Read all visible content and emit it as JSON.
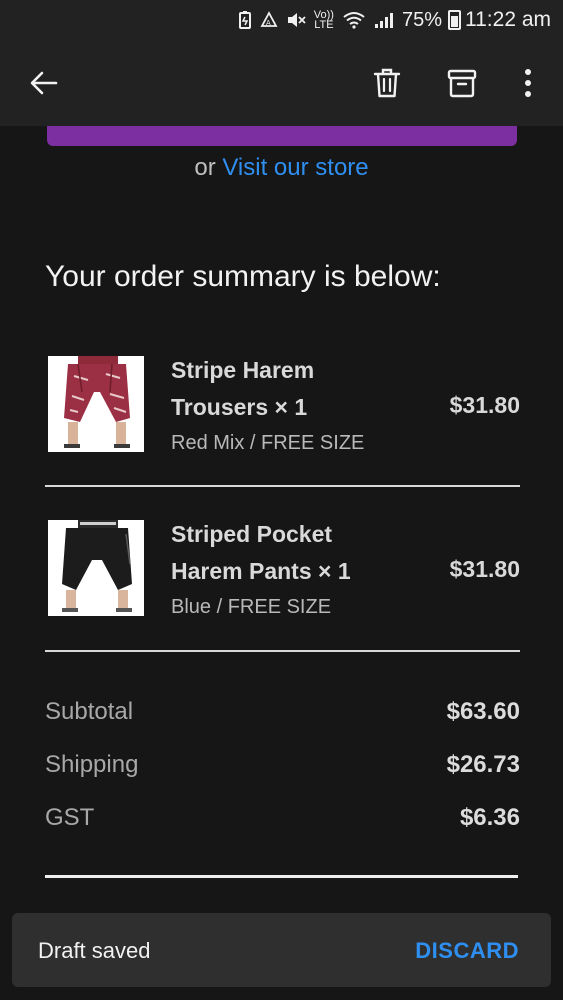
{
  "status_bar": {
    "volte": "Vo))",
    "lte": "LTE",
    "battery_percent": "75%",
    "time": "11:22 am"
  },
  "toolbar": {
    "back_icon": "arrow-left-icon",
    "delete_icon": "trash-icon",
    "archive_icon": "archive-icon",
    "more_icon": "more-vert-icon"
  },
  "email": {
    "visit_prefix": "or",
    "visit_link": "Visit our store",
    "summary_title": "Your order summary is below:",
    "items": [
      {
        "name_line1": "Stripe Harem",
        "name_line2": "Trousers × 1",
        "variant": "Red Mix / FREE SIZE",
        "price": "$31.80"
      },
      {
        "name_line1": "Striped Pocket",
        "name_line2": "Harem Pants × 1",
        "variant": "Blue / FREE SIZE",
        "price": "$31.80"
      }
    ],
    "totals": [
      {
        "label": "Subtotal",
        "value": "$63.60"
      },
      {
        "label": "Shipping",
        "value": "$26.73"
      },
      {
        "label": "GST",
        "value": "$6.36"
      }
    ]
  },
  "snackbar": {
    "message": "Draft saved",
    "action": "DISCARD"
  },
  "colors": {
    "accent_link": "#2f8ff0",
    "button_purple": "#7b2fa0",
    "background": "#161616"
  }
}
